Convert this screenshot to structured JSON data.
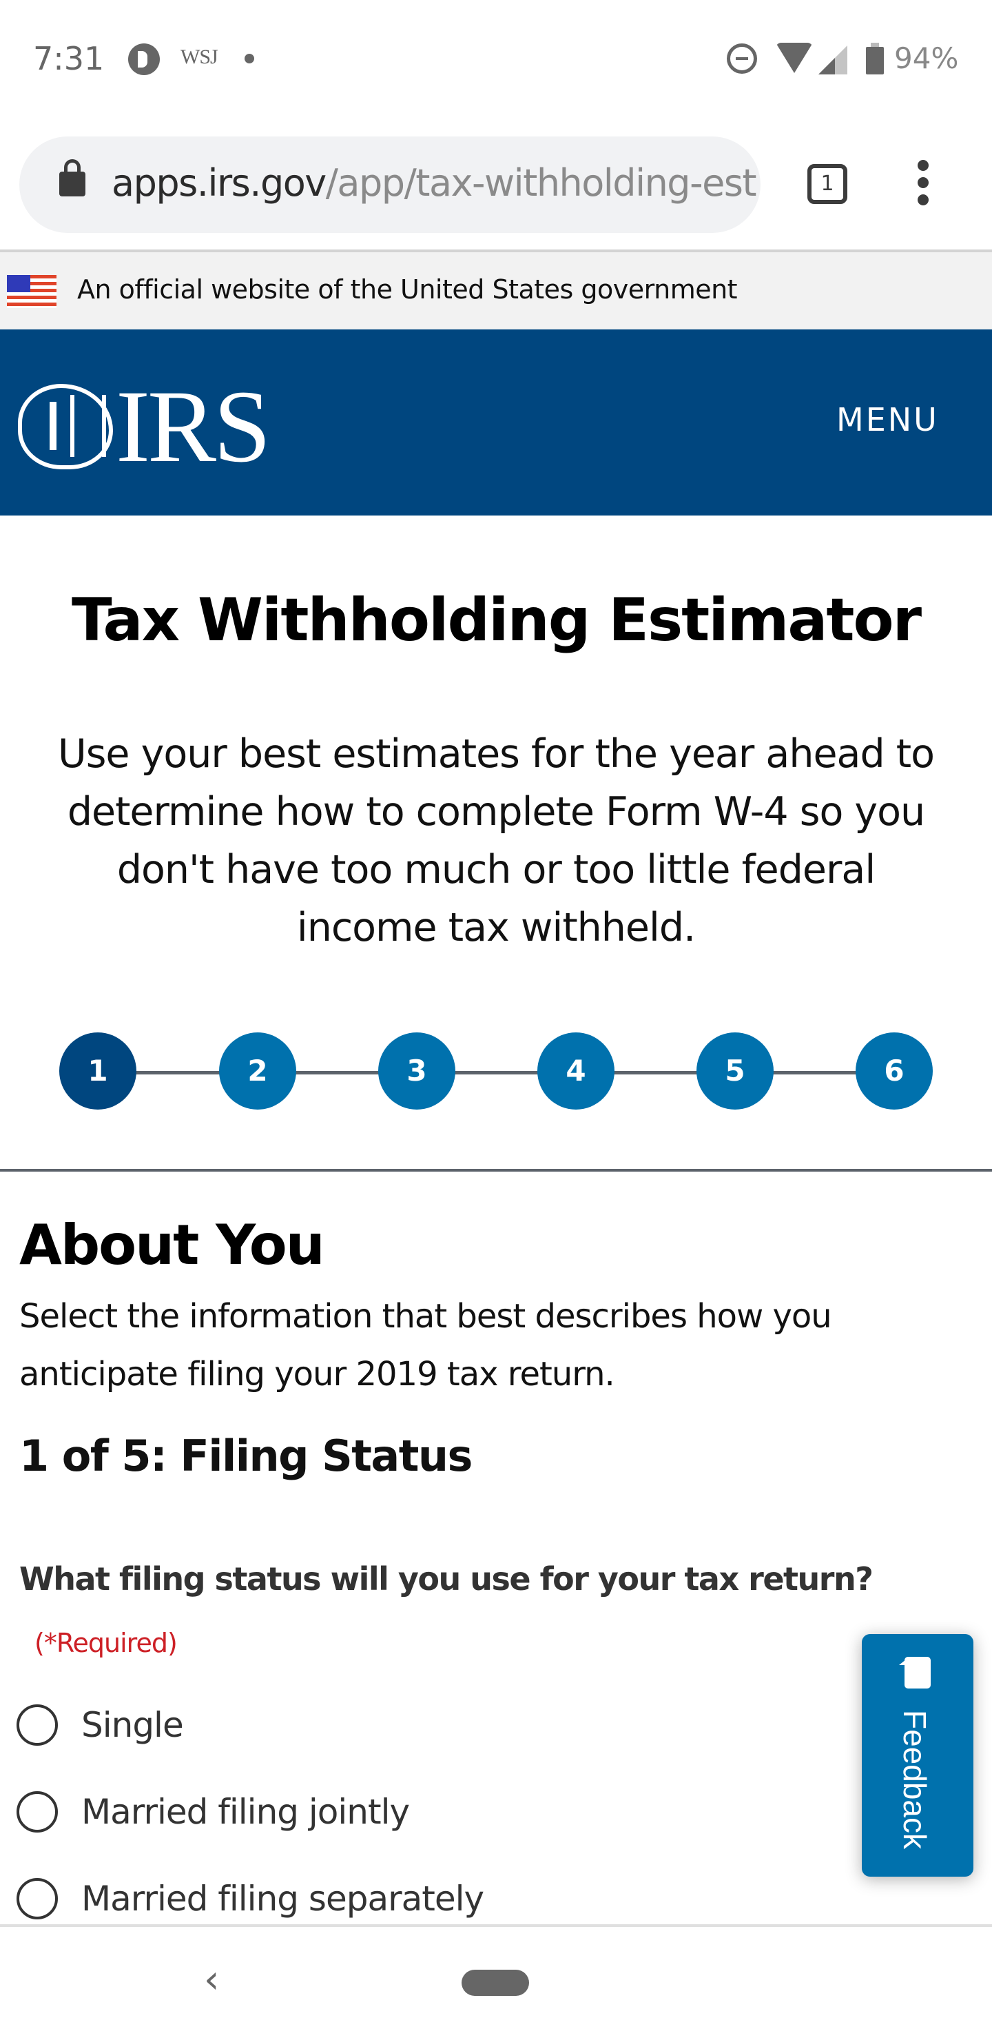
{
  "status_bar": {
    "time": "7:31",
    "notification_icons": [
      "pandora-icon",
      "wsj-icon",
      "dot-icon"
    ],
    "wsj_label": "WSJ",
    "system_icons": [
      "do-not-disturb-icon",
      "wifi-icon",
      "signal-icon",
      "battery-icon"
    ],
    "battery_percent": "94%"
  },
  "browser": {
    "url_host": "apps.irs.gov",
    "url_path": "/app/tax-withholding-est",
    "tab_count": "1"
  },
  "gov_banner": {
    "text": "An official website of the United States government"
  },
  "header": {
    "logo_text": "IRS",
    "menu_label": "MENU",
    "background_color": "#00467f"
  },
  "main": {
    "title": "Tax Withholding Estimator",
    "intro": "Use your best estimates for the year ahead to determine how to complete Form W-4 so you don't have too much or too little federal income tax withheld.",
    "steps": [
      {
        "label": "1",
        "active": true
      },
      {
        "label": "2",
        "active": false
      },
      {
        "label": "3",
        "active": false
      },
      {
        "label": "4",
        "active": false
      },
      {
        "label": "5",
        "active": false
      },
      {
        "label": "6",
        "active": false
      }
    ],
    "step_colors": {
      "active": "#00467f",
      "inactive": "#0071ad"
    }
  },
  "section": {
    "title": "About You",
    "description": "Select the information that best describes how you anticipate filing your 2019 tax return.",
    "subtitle": "1 of 5: Filing Status",
    "question": "What filing status will you use for your tax return?",
    "required_label": "(*Required)",
    "required_color": "#cd2026",
    "options": [
      {
        "label": "Single",
        "selected": false
      },
      {
        "label": "Married filing jointly",
        "selected": false
      },
      {
        "label": "Married filing separately",
        "selected": false
      }
    ]
  },
  "feedback": {
    "label": "Feedback",
    "color": "#0071ad"
  },
  "nav_bar": {
    "back_glyph": "‹"
  }
}
